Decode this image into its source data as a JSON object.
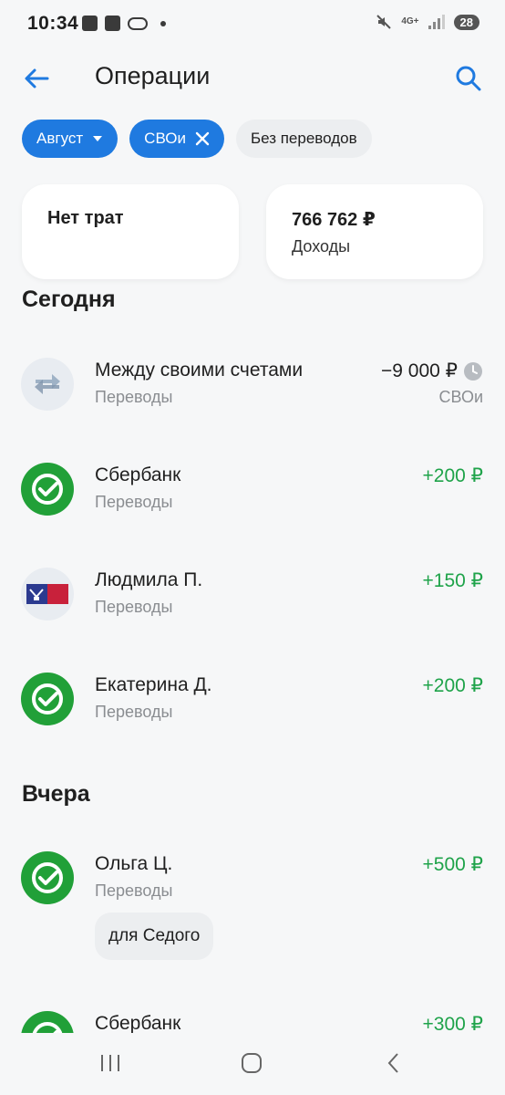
{
  "status_bar": {
    "time": "10:34",
    "network": "4G+",
    "battery": "28"
  },
  "header": {
    "title": "Операции",
    "back_icon": "arrow-left-icon",
    "search_icon": "search-icon"
  },
  "filters": [
    {
      "label": "Август",
      "state": "active",
      "icon": "caret-down-icon"
    },
    {
      "label": "СВОи",
      "state": "active",
      "icon": "close-icon"
    },
    {
      "label": "Без переводов",
      "state": "inactive"
    }
  ],
  "summary": {
    "expenses": "Нет трат",
    "income_amount": "766 762 ₽",
    "income_label": "Доходы"
  },
  "sections": [
    {
      "title": "Сегодня",
      "items": [
        {
          "name": "Между своими счетами",
          "category": "Переводы",
          "amount": "−9 000 ₽",
          "account": "СВОи",
          "avatar": "transfer-icon",
          "pending": true
        },
        {
          "name": "Сбербанк",
          "category": "Переводы",
          "amount": "+200 ₽",
          "account": "",
          "avatar": "sberbank-logo"
        },
        {
          "name": "Людмила П.",
          "category": "Переводы",
          "amount": "+150 ₽",
          "account": "",
          "avatar": "pochta-bank-logo"
        },
        {
          "name": "Екатерина Д.",
          "category": "Переводы",
          "amount": "+200 ₽",
          "account": "",
          "avatar": "sberbank-logo"
        }
      ]
    },
    {
      "title": "Вчера",
      "items": [
        {
          "name": "Ольга Ц.",
          "category": "Переводы",
          "amount": "+500 ₽",
          "comment": "для Седого",
          "avatar": "sberbank-logo"
        },
        {
          "name": "Сбербанк",
          "category": "",
          "amount": "+300 ₽",
          "avatar": "sberbank-logo"
        }
      ]
    }
  ],
  "colors": {
    "accent": "#1f7ae0",
    "income": "#1fa34a",
    "sber_green": "#21a038",
    "background": "#f6f7f8"
  }
}
